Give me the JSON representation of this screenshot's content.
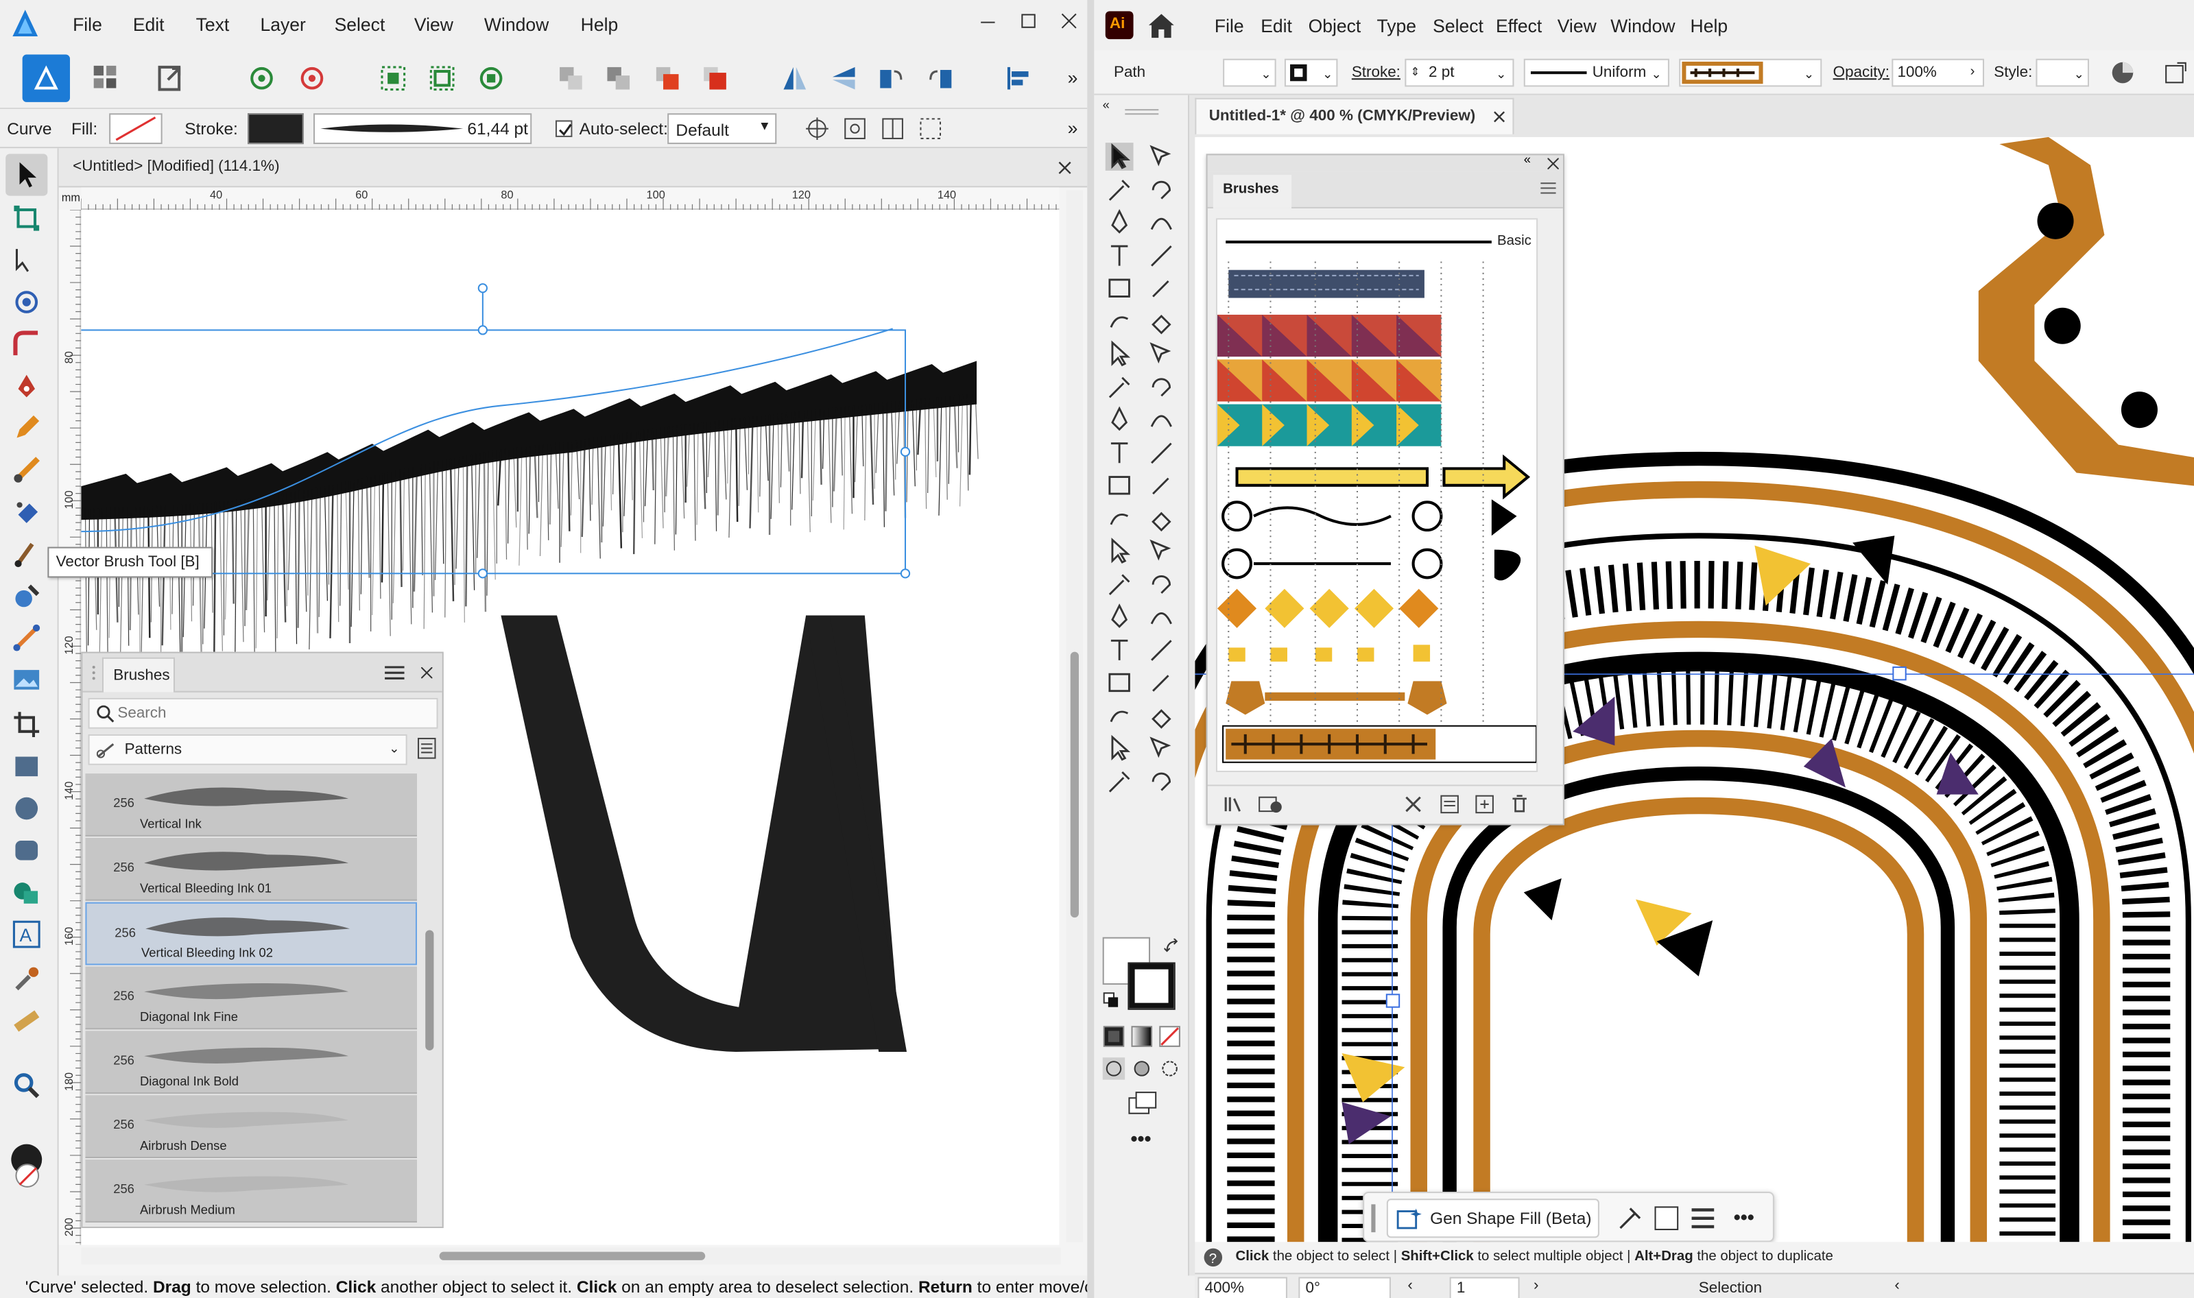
{
  "colors": {
    "affinity_blue": "#1c7bd6",
    "illustrator_orange": "#ff9a00",
    "gold": "#c27b24",
    "purple": "#4b2d6e",
    "yellow": "#f2c233"
  },
  "left_app": {
    "name": "Affinity Designer",
    "menu": [
      "File",
      "Edit",
      "Text",
      "Layer",
      "Select",
      "View",
      "Window",
      "Help"
    ],
    "context": {
      "tool": "Curve",
      "fill_label": "Fill:",
      "stroke_label": "Stroke:",
      "stroke_width": "61,44 pt",
      "autoselect_label": "Auto-select:",
      "autoselect_value": "Default"
    },
    "doc_tab": "<Untitled> [Modified] (114.1%)",
    "ruler_unit": "mm",
    "ruler_h": [
      "40",
      "60",
      "80",
      "100",
      "120",
      "140"
    ],
    "ruler_v": [
      "80",
      "100",
      "120",
      "140",
      "160",
      "180",
      "200"
    ],
    "tooltip": "Vector Brush Tool [B]",
    "brushes_panel": {
      "title": "Brushes",
      "search_placeholder": "Search",
      "category": "Patterns",
      "items": [
        {
          "size": "256",
          "name": "Vertical Ink"
        },
        {
          "size": "256",
          "name": "Vertical Bleeding Ink 01"
        },
        {
          "size": "256",
          "name": "Vertical Bleeding Ink 02"
        },
        {
          "size": "256",
          "name": "Diagonal Ink Fine"
        },
        {
          "size": "256",
          "name": "Diagonal Ink Bold"
        },
        {
          "size": "256",
          "name": "Airbrush Dense"
        },
        {
          "size": "256",
          "name": "Airbrush Medium"
        }
      ]
    },
    "status": {
      "p1": "'Curve' selected. ",
      "b1": "Drag",
      "p2": " to move selection. ",
      "b2": "Click",
      "p3": " another object to select it. ",
      "b3": "Click",
      "p4": " on an empty area to deselect selection. ",
      "b4": "Return",
      "p5": " to enter move/c"
    }
  },
  "right_app": {
    "name": "Adobe Illustrator",
    "logo": "Ai",
    "menu": [
      "File",
      "Edit",
      "Object",
      "Type",
      "Select",
      "Effect",
      "View",
      "Window",
      "Help"
    ],
    "control": {
      "object": "Path",
      "stroke_label": "Stroke:",
      "stroke_value": "2 pt",
      "profile": "Uniform",
      "opacity_label": "Opacity:",
      "opacity_value": "100%",
      "style_label": "Style:"
    },
    "doc_tab": "Untitled-1* @ 400 % (CMYK/Preview)",
    "brushes_panel": {
      "title": "Brushes",
      "basic_label": "Basic"
    },
    "contextual_bar": {
      "gen_fill": "Gen Shape Fill (Beta)"
    },
    "hint": {
      "b1": "Click",
      "t1": " the object to select  |  ",
      "b2": "Shift+Click",
      "t2": " to select multiple object  |  ",
      "b3": "Alt+Drag",
      "t3": " the object to duplicate"
    },
    "status": {
      "zoom": "400%",
      "rotation": "0°",
      "artboard": "1",
      "mode": "Selection"
    }
  }
}
